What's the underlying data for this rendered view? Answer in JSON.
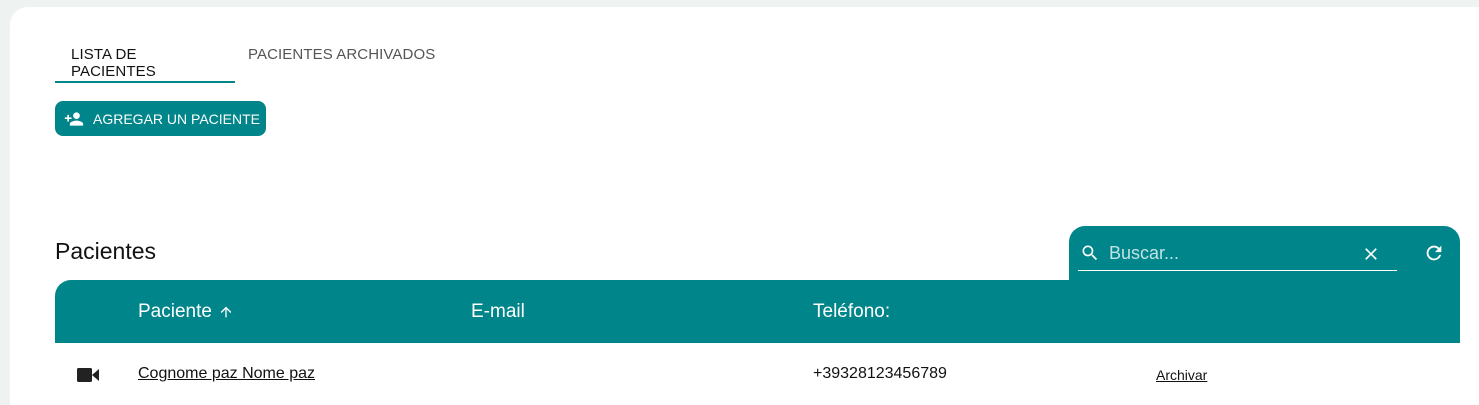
{
  "tabs": [
    {
      "label": "LISTA DE PACIENTES",
      "active": true
    },
    {
      "label": "PACIENTES ARCHIVADOS",
      "active": false
    }
  ],
  "add_button": {
    "label": "AGREGAR UN PACIENTE",
    "icon": "person-add-icon"
  },
  "section": {
    "title": "Pacientes"
  },
  "search": {
    "placeholder": "Buscar...",
    "value": "",
    "icon": "search-icon"
  },
  "table": {
    "columns": [
      {
        "label": "Paciente",
        "sort": "ascending",
        "sort_icon": "arrow-up-icon"
      },
      {
        "label": "E-mail"
      },
      {
        "label": "Teléfono:"
      }
    ],
    "rows": [
      {
        "icon": "video-camera-icon",
        "patient": "Cognome paz Nome paz",
        "email": "",
        "phone": "+39328123456789",
        "action": "Archivar"
      }
    ]
  },
  "colors": {
    "accent": "#00858a",
    "background": "#eef3f1",
    "card": "#ffffff"
  }
}
